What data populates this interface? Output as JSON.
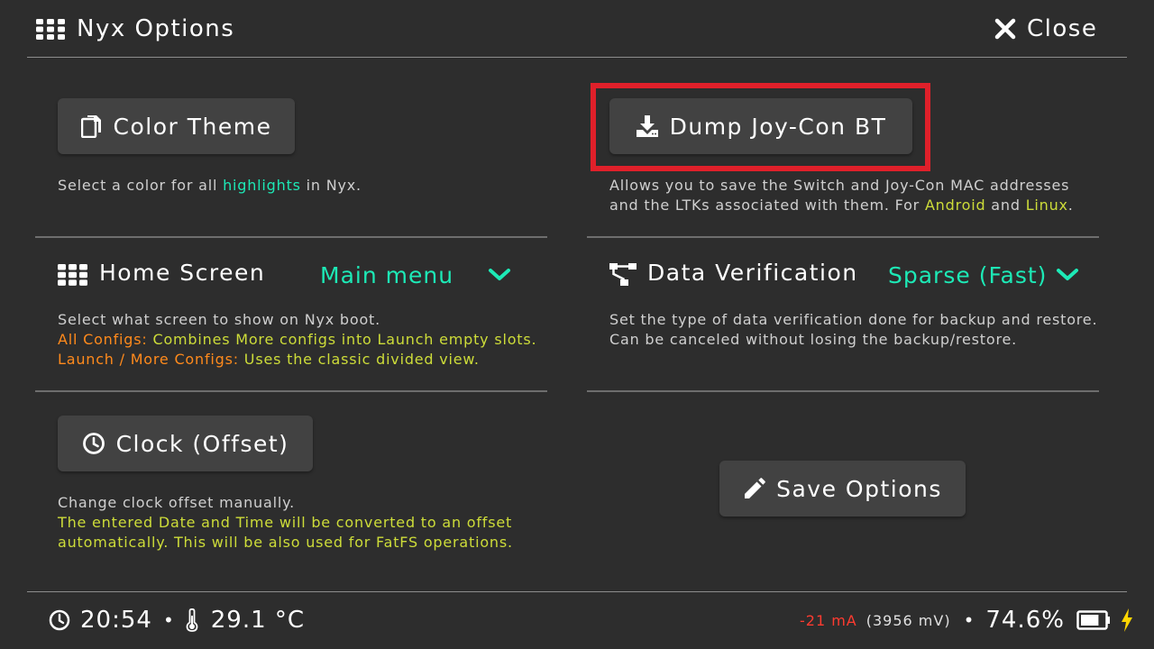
{
  "header": {
    "title": "Nyx Options",
    "close_label": "Close"
  },
  "color_theme": {
    "button_label": "Color Theme",
    "desc_prefix": "Select a color for all ",
    "desc_highlight": "highlights",
    "desc_suffix": " in Nyx."
  },
  "dump_joycon": {
    "button_label": "Dump Joy-Con BT",
    "desc_line1": "Allows you to save the Switch and Joy-Con MAC addresses",
    "desc_line2_prefix": "and the LTKs associated with them. For ",
    "desc_android": "Android",
    "desc_and": " and ",
    "desc_linux": "Linux",
    "desc_period": "."
  },
  "home_screen": {
    "label": "Home Screen",
    "selected": "Main menu",
    "desc_line1": "Select what screen to show on Nyx boot.",
    "desc_line2_key": "All Configs:",
    "desc_line2_val": " Combines More configs into Launch empty slots.",
    "desc_line3_key": "Launch / More Configs:",
    "desc_line3_val": " Uses the classic divided view."
  },
  "data_verification": {
    "label": "Data Verification",
    "selected": "Sparse (Fast)",
    "desc_line1": "Set the type of data verification done for backup and restore.",
    "desc_line2": "Can be canceled without losing the backup/restore."
  },
  "clock": {
    "button_label": "Clock (Offset)",
    "desc_line1": "Change clock offset manually.",
    "desc_line2": "The entered Date and Time will be converted to an offset",
    "desc_line3": "automatically. This will be also used for FatFS operations."
  },
  "save": {
    "button_label": "Save Options"
  },
  "footer": {
    "time": "20:54",
    "separator": "•",
    "temperature": "29.1 °C",
    "current": "-21 mA",
    "voltage": "(3956 mV)",
    "battery_percent": "74.6%"
  },
  "colors": {
    "accent": "#1de9b6",
    "note": "#cddc39",
    "warning": "#ff8a1c",
    "current": "#ff3b30",
    "charging": "#ffd600",
    "highlight_box": "#e0202a"
  }
}
